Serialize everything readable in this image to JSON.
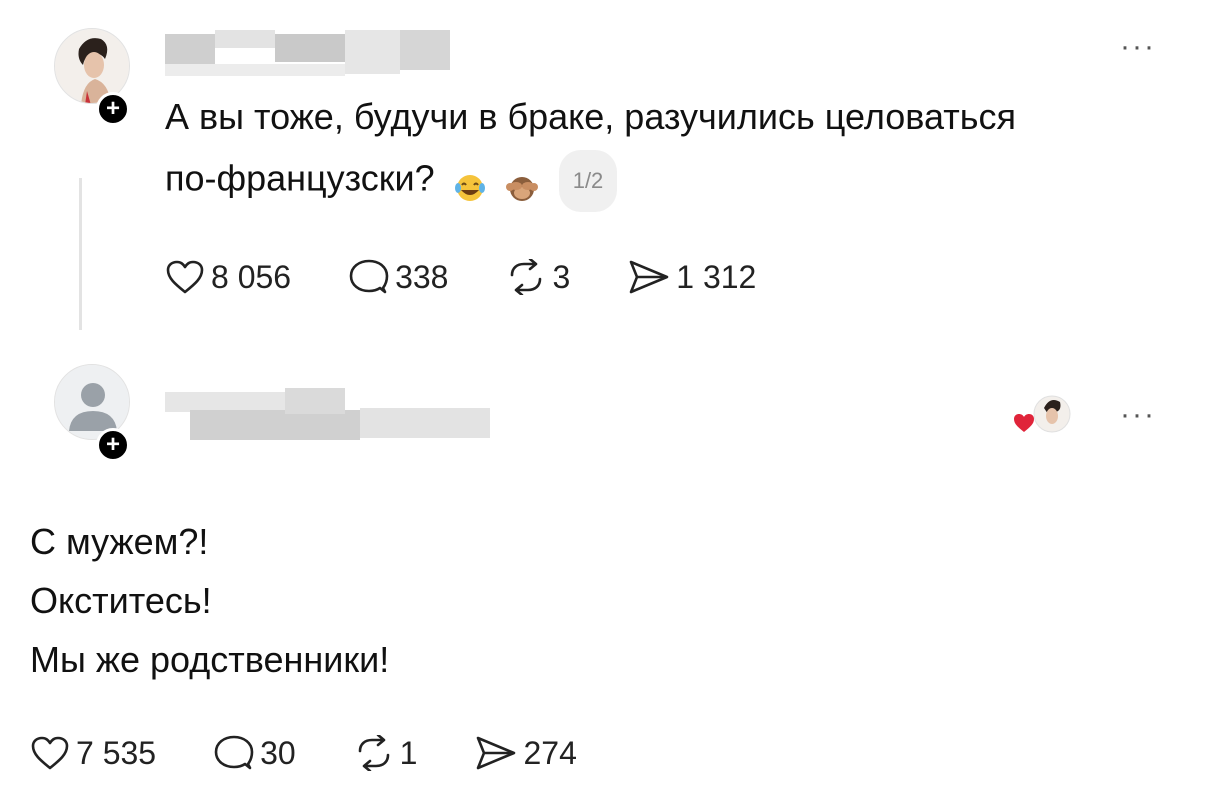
{
  "post": {
    "text_line1": "А вы тоже, будучи в браке, разучились целоваться",
    "text_line2": "по-французски?",
    "page_indicator": "1/2",
    "likes": "8 056",
    "replies": "338",
    "reposts": "3",
    "shares": "1 312"
  },
  "reply": {
    "lines": [
      "С мужем?!",
      "Окститесь!",
      "Мы же родственники!"
    ],
    "likes": "7 535",
    "replies": "30",
    "reposts": "1",
    "shares": "274"
  },
  "icons": {
    "more": "more-dots-icon",
    "like": "heart-icon",
    "reply": "comment-bubble-icon",
    "repost": "repost-arrows-icon",
    "share": "send-arrow-icon",
    "follow": "plus-icon"
  },
  "colors": {
    "liked_heart": "#e0243a",
    "badge": "#000000",
    "muted": "#8a8a8a"
  }
}
